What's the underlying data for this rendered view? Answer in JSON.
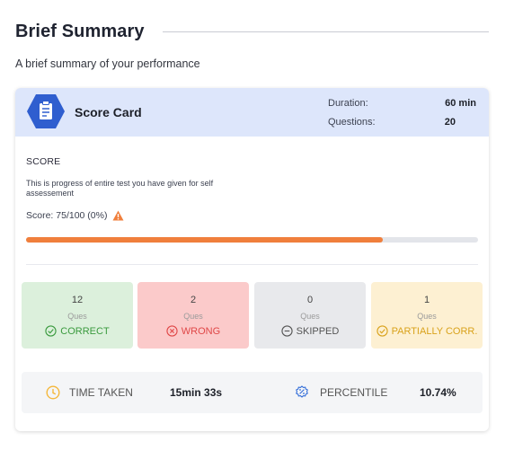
{
  "header": {
    "title": "Brief Summary",
    "subtitle": "A brief summary of your performance"
  },
  "scorecard": {
    "title": "Score Card",
    "duration_label": "Duration:",
    "duration_value": "60 min",
    "questions_label": "Questions:",
    "questions_value": "20"
  },
  "score": {
    "heading": "SCORE",
    "description": "This is  progress of entire test you have given for self assessement",
    "line": "Score: 75/100 (0%)",
    "progress": 0.79
  },
  "stats": [
    {
      "count": "12",
      "unit": "Ques",
      "label": "CORRECT",
      "icon": "check-circle-icon",
      "bg": "#dcf0dc",
      "color": "#3a9a3e"
    },
    {
      "count": "2",
      "unit": "Ques",
      "label": "WRONG",
      "icon": "x-circle-icon",
      "bg": "#fbcaca",
      "color": "#e04848"
    },
    {
      "count": "0",
      "unit": "Ques",
      "label": "SKIPPED",
      "icon": "minus-circle-icon",
      "bg": "#e8e9ec",
      "color": "#555555"
    },
    {
      "count": "1",
      "unit": "Ques",
      "label": "PARTIALLY CORR.",
      "icon": "check-circle-icon",
      "bg": "#fdf0d2",
      "color": "#d9a21b"
    }
  ],
  "footer": {
    "time_label": "TIME TAKEN",
    "time_value": "15min 33s",
    "percentile_label": "PERCENTILE",
    "percentile_value": "10.74%"
  },
  "colors": {
    "accent": "#2f5ecf",
    "progress": "#f07f3c",
    "warning": "#f07f3c",
    "clock": "#f4b73b"
  }
}
